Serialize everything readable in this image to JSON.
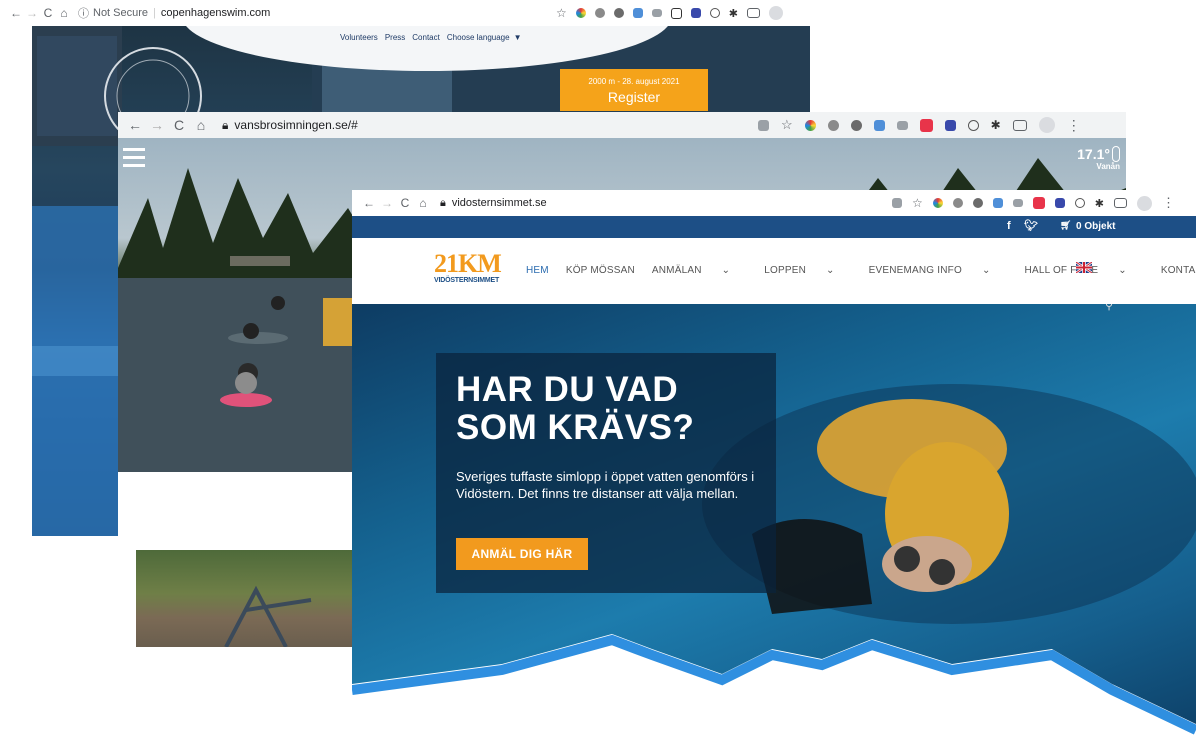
{
  "windows": [
    {
      "url": "copenhagenswim.com",
      "security_label": "Not Secure",
      "site_nav": [
        "Volunteers",
        "Press",
        "Contact",
        "Choose language"
      ],
      "register_date": "2000 m - 28. august 2021",
      "register_label": "Register"
    },
    {
      "url": "vansbrosimningen.se/#",
      "temperature": "17.1°",
      "location": "Vanån"
    },
    {
      "url": "vidosternsimmet.se",
      "topbar": {
        "cart_label": "0 Objekt"
      },
      "logo": {
        "big": "21KM",
        "small": "VIDÖSTERNSIMMET"
      },
      "menu": [
        "HEM",
        "KÖP MÖSSAN",
        "ANMÄLAN",
        "LOPPEN",
        "EVENEMANG INFO",
        "HALL OF FAME",
        "KONTAKT"
      ],
      "hero": {
        "headline": "HAR DU VAD SOM KRÄVS?",
        "subtext": "Sveriges tuffaste simlopp i öppet vatten genomförs i Vidöstern. Det finns tre distanser att välja mellan.",
        "cta_label": "ANMÄL DIG HÄR"
      }
    }
  ],
  "colors": {
    "brand_blue": "#1d4f86",
    "menu_active": "#2b6cb0",
    "cta_orange": "#f29a1e"
  }
}
